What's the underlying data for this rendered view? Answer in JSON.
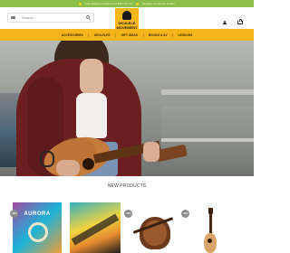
{
  "topbar": {
    "text_left": "Free shipping on orders over $49 in the US",
    "text_right": "Ukuleles, Accessories & More"
  },
  "header": {
    "search": {
      "placeholder": "Search..."
    },
    "logo": {
      "line1": "UKULELE",
      "line2": "MOVEMENT"
    }
  },
  "nav": {
    "items": [
      "ACCESSORIES",
      "UKULELES",
      "GIFT IDEAS",
      "BOOKS & AV",
      "LESSONS"
    ]
  },
  "section": {
    "title": "NEW PRODUCTS"
  },
  "products": [
    {
      "badge": "-10%",
      "pack_text": "AURORA"
    },
    {
      "badge": ""
    },
    {
      "badge": "-10%"
    },
    {
      "badge": "-10%"
    }
  ],
  "colors": {
    "accent": "#f4b51a",
    "topbar_green": "#8bbf4a",
    "text_dark": "#3a2a08"
  }
}
